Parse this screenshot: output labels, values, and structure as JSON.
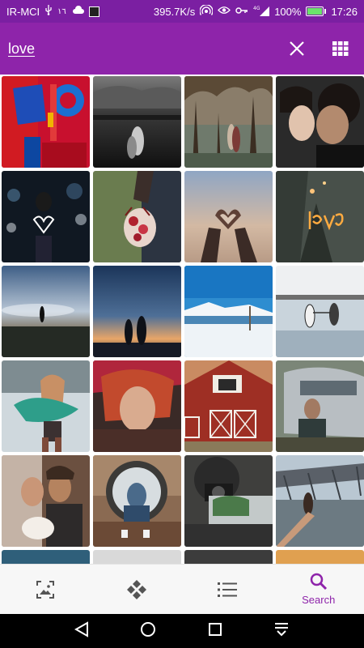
{
  "status_bar": {
    "carrier": "IR-MCI",
    "network_speed": "395.7K/s",
    "battery_percent": "100%",
    "time": "17:26",
    "signal_label": "4G",
    "icons": [
      "usb-icon",
      "app-notification-icon",
      "hotspot-icon",
      "eye-icon",
      "key-icon",
      "signal-icon",
      "battery-icon"
    ]
  },
  "app_bar": {
    "search_query": "love",
    "actions": [
      "close-icon",
      "grid-view-icon"
    ],
    "color": "#8e24aa",
    "status_color": "#7b1fa2"
  },
  "grid": {
    "columns": 4,
    "images": [
      "love-sculpture",
      "couple-beach-night",
      "couple-under-trees",
      "couple-kiss-closeup",
      "girl-heart-sparkler",
      "girl-holding-bouquet",
      "hands-heart-sunset",
      "love-light-writing",
      "person-sunset-sky",
      "couple-walking-dusk",
      "snowy-mountain-lake",
      "couple-beach-water",
      "woman-winter-scarf",
      "woman-red-hair",
      "red-barn",
      "man-silver-trailer",
      "wedding-couple",
      "woman-round-window",
      "man-with-camera",
      "couple-holding-hands-bridge"
    ]
  },
  "bottom_nav": {
    "items": [
      {
        "icon": "image-icon",
        "label": ""
      },
      {
        "icon": "categories-icon",
        "label": ""
      },
      {
        "icon": "list-icon",
        "label": ""
      },
      {
        "icon": "search-icon",
        "label": "Search"
      }
    ],
    "active_color": "#8e24aa",
    "inactive_color": "#666666"
  },
  "system_nav": [
    "back-icon",
    "home-icon",
    "recents-icon",
    "notifications-icon"
  ]
}
